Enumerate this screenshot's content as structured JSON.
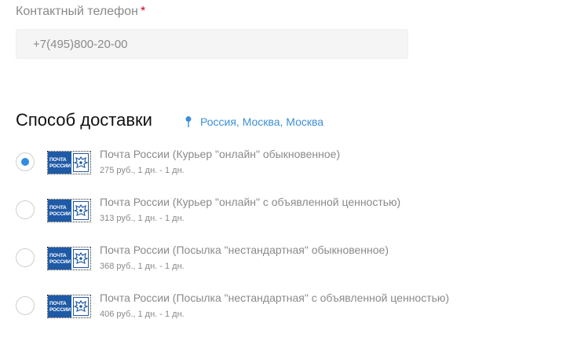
{
  "contact": {
    "label": "Контактный телефон",
    "required_mark": "*",
    "value": "+7(495)800-20-00"
  },
  "delivery": {
    "title": "Способ доставки",
    "location_icon": "map-pin-icon",
    "location": "Россия, Москва, Москва",
    "logo_text_line1": "ПОЧТА",
    "logo_text_line2": "РОССИИ",
    "options": [
      {
        "name": "Почта России (Курьер \"онлайн\" обыкновенное)",
        "price": "275 руб., 1 дн. - 1 дн.",
        "selected": true
      },
      {
        "name": "Почта России (Курьер \"онлайн\" с объявленной ценностью)",
        "price": "313 руб., 1 дн. - 1 дн.",
        "selected": false
      },
      {
        "name": "Почта России (Посылка \"нестандартная\" обыкновенное)",
        "price": "368 руб., 1 дн. - 1 дн.",
        "selected": false
      },
      {
        "name": "Почта России (Посылка \"нестандартная\" с объявленной ценностью)",
        "price": "406 руб., 1 дн. - 1 дн.",
        "selected": false
      }
    ]
  },
  "colors": {
    "accent": "#2f8de4",
    "link": "#3d8fd6",
    "required": "#d0021b",
    "logo_blue": "#1f5aa6"
  }
}
